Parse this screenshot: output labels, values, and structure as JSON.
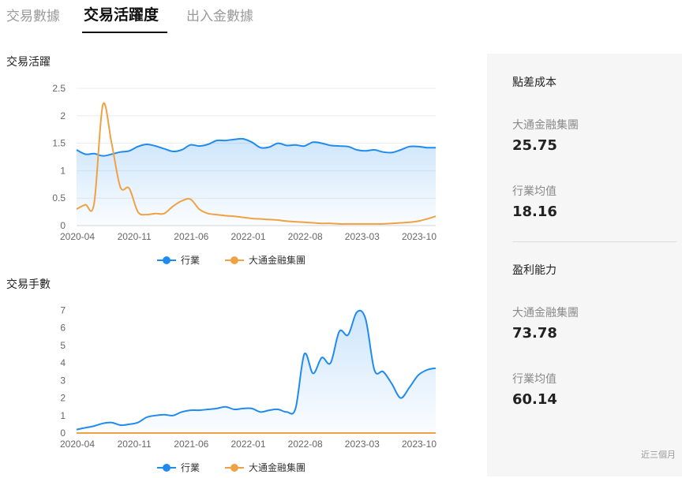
{
  "tabs": [
    {
      "label": "交易數據",
      "active": false
    },
    {
      "label": "交易活躍度",
      "active": true
    },
    {
      "label": "出入金數據",
      "active": false
    }
  ],
  "chart_data": [
    {
      "type": "line",
      "title": "交易活躍",
      "x_tick_labels": [
        "2020-04",
        "2020-11",
        "2021-06",
        "2022-01",
        "2022-08",
        "2023-03",
        "2023-10"
      ],
      "y_ticks": [
        "0",
        "0.5",
        "1",
        "1.5",
        "2",
        "2.5"
      ],
      "ylim": [
        0,
        2.5
      ],
      "grid": true,
      "legend_position": "bottom",
      "series": [
        {
          "name": "行業",
          "color": "#1f8bef",
          "area": true,
          "values": [
            1.38,
            1.3,
            1.31,
            1.27,
            1.3,
            1.34,
            1.36,
            1.44,
            1.48,
            1.45,
            1.4,
            1.35,
            1.38,
            1.47,
            1.45,
            1.48,
            1.55,
            1.55,
            1.57,
            1.58,
            1.52,
            1.42,
            1.43,
            1.5,
            1.46,
            1.47,
            1.45,
            1.52,
            1.5,
            1.46,
            1.45,
            1.44,
            1.38,
            1.36,
            1.38,
            1.34,
            1.33,
            1.38,
            1.44,
            1.44,
            1.42,
            1.42
          ]
        },
        {
          "name": "大通金融集團",
          "color": "#f0a143",
          "area": false,
          "values": [
            0.3,
            0.38,
            0.4,
            2.2,
            1.5,
            0.7,
            0.68,
            0.25,
            0.2,
            0.22,
            0.22,
            0.35,
            0.45,
            0.48,
            0.3,
            0.22,
            0.2,
            0.18,
            0.17,
            0.15,
            0.13,
            0.12,
            0.11,
            0.1,
            0.08,
            0.07,
            0.06,
            0.05,
            0.04,
            0.04,
            0.03,
            0.03,
            0.03,
            0.03,
            0.03,
            0.03,
            0.04,
            0.05,
            0.06,
            0.08,
            0.12,
            0.17
          ]
        }
      ]
    },
    {
      "type": "line",
      "title": "交易手數",
      "x_tick_labels": [
        "2020-04",
        "2020-11",
        "2021-06",
        "2022-01",
        "2022-08",
        "2023-03",
        "2023-10"
      ],
      "y_ticks": [
        "0",
        "1",
        "2",
        "3",
        "4",
        "5",
        "6",
        "7"
      ],
      "ylim": [
        0,
        7.2
      ],
      "grid": false,
      "legend_position": "bottom",
      "series": [
        {
          "name": "行業",
          "color": "#1f8bef",
          "area": true,
          "values": [
            0.2,
            0.3,
            0.4,
            0.55,
            0.6,
            0.45,
            0.5,
            0.6,
            0.9,
            1.0,
            1.05,
            1.0,
            1.2,
            1.3,
            1.3,
            1.35,
            1.4,
            1.5,
            1.35,
            1.4,
            1.4,
            1.2,
            1.3,
            1.35,
            1.2,
            1.4,
            4.5,
            3.4,
            4.3,
            4.0,
            5.8,
            5.6,
            6.9,
            6.5,
            3.6,
            3.5,
            2.8,
            2.0,
            2.6,
            3.3,
            3.6,
            3.7
          ]
        },
        {
          "name": "大通金融集團",
          "color": "#f0a143",
          "area": false,
          "values": [
            0,
            0,
            0,
            0,
            0,
            0,
            0,
            0,
            0,
            0,
            0,
            0,
            0,
            0,
            0,
            0,
            0,
            0,
            0,
            0,
            0,
            0,
            0,
            0,
            0,
            0,
            0,
            0,
            0,
            0,
            0,
            0,
            0,
            0,
            0,
            0,
            0,
            0,
            0,
            0,
            0,
            0
          ]
        }
      ]
    }
  ],
  "panel": {
    "section1": {
      "heading": "點差成本",
      "company_label": "大通金融集團",
      "company_value": "25.75",
      "industry_label": "行業均值",
      "industry_value": "18.16"
    },
    "section2": {
      "heading": "盈利能力",
      "company_label": "大通金融集團",
      "company_value": "73.78",
      "industry_label": "行業均值",
      "industry_value": "60.14"
    },
    "footnote": "近三個月"
  }
}
